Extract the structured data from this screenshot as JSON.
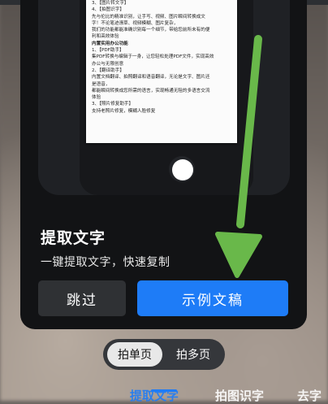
{
  "document": {
    "lines": [
      "3、【图片转文字】",
      "4、【拍图识字】",
      "先与伦比的精准识别，让手写、视频、图片瞬间转换成文",
      "字！不论笔迹潦草、视频模糊、图片复杂，",
      "我们的功能都能准确识别每一个细节，带给您前所未有的便",
      "利和高效体验",
      "内置实用办公功能",
      "1、【PDF助手】",
      "集PDF转换与编辑于一身，让您轻松处理PDF文件，实现高效",
      "办公与无限创意",
      "2、【翻译助手】",
      "内置文档翻译、拍照翻译和语音翻译，无论是文字、图片还",
      "是语音，",
      "都能瞬间转换成您所需的语言，实现畅通无阻的多语言交流",
      "体验",
      "3、【照片修复助手】",
      "支持老照片修复，模糊人脸修复"
    ],
    "head_index": 6
  },
  "dialog": {
    "title": "提取文字",
    "subtitle": "一键提取文字，快速复制",
    "skip_label": "跳过",
    "sample_label": "示例文稿"
  },
  "mode_toggle": {
    "active": "拍单页",
    "inactive": "拍多页"
  },
  "tabs": [
    "提取文字",
    "拍图识字",
    "去字"
  ],
  "colors": {
    "accent": "#1e7cf7",
    "arrow": "#69b84a"
  }
}
